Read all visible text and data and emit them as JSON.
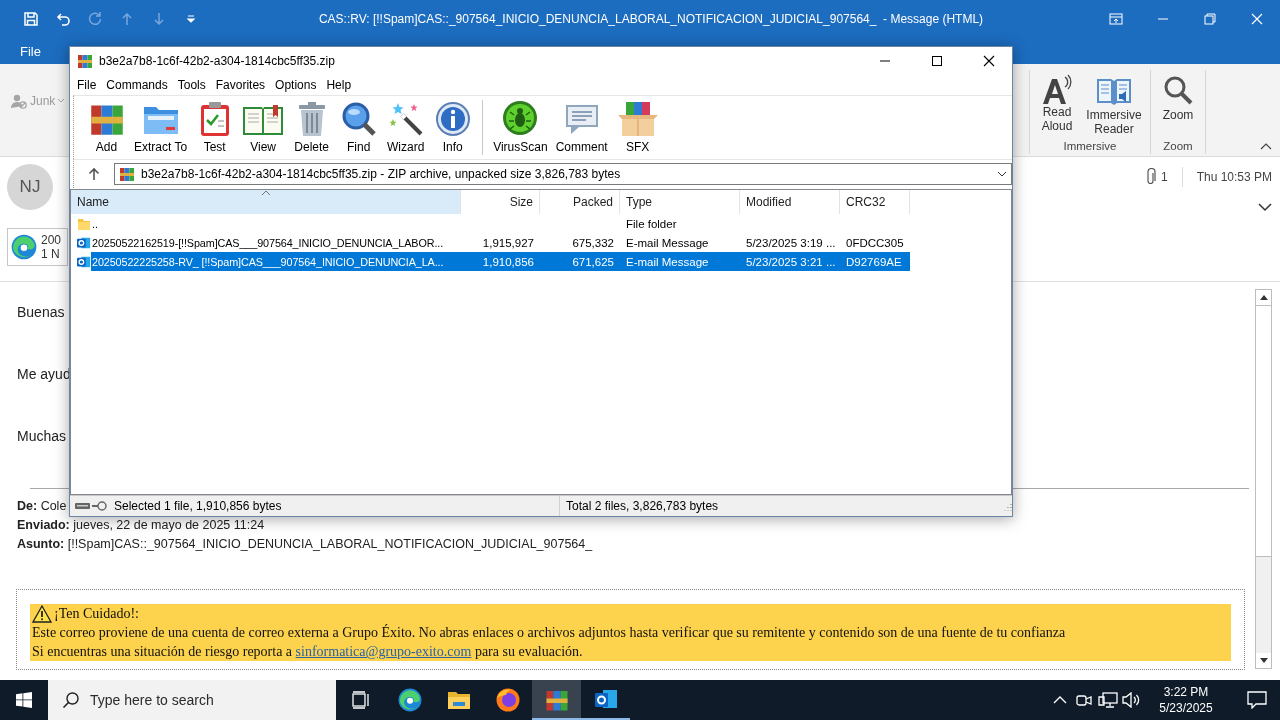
{
  "outlook": {
    "title": "CAS::RV: [!!Spam]CAS::_907564_INICIO_DENUNCIA_LABORAL_NOTIFICACION_JUDICIAL_907564_  - Message (HTML)",
    "tabs": [
      {
        "label": "File",
        "selected": false
      }
    ],
    "ribbon": {
      "junk": {
        "label": "Junk",
        "disabled": true
      },
      "groups": [
        {
          "label": "Immersive",
          "buttons": [
            "Read Aloud",
            "Immersive Reader"
          ]
        },
        {
          "label": "Zoom",
          "buttons": [
            "Zoom"
          ]
        }
      ]
    },
    "header": {
      "avatar": "NJ",
      "attachment_count": "1",
      "received": "Thu 10:53 PM",
      "attachment": {
        "name": "200",
        "size": "1 N"
      }
    },
    "body": {
      "lines": [
        "Buenas",
        "Me ayud",
        "Muchas"
      ],
      "fields": [
        {
          "label": "De:",
          "value": "Cole"
        },
        {
          "label": "Enviado:",
          "value": "jueves, 22 de mayo de 2025 11:24"
        },
        {
          "label": "Asunto:",
          "value": "[!!Spam]CAS::_907564_INICIO_DENUNCIA_LABORAL_NOTIFICACION_JUDICIAL_907564_"
        }
      ],
      "warning": {
        "title": "¡Ten Cuidado!:",
        "text": "Este correo proviene de una cuenta de correo externa a Grupo Éxito. No abras enlaces o archivos adjuntos hasta verificar que su remitente y contenido son de una fuente de tu confianza",
        "report": "Si encuentras una situación de riesgo reporta a",
        "link": "sinformatica@grupo-exito.com",
        "after_link": "para su evaluación."
      }
    }
  },
  "archive": {
    "title": "b3e2a7b8-1c6f-42b2-a304-1814cbc5ff35.zip",
    "menu": [
      "File",
      "Commands",
      "Tools",
      "Favorites",
      "Options",
      "Help"
    ],
    "toolbar_groups": [
      {
        "buttons": [
          "Add",
          "Extract To",
          "Test",
          "View",
          "Delete",
          "Find",
          "Wizard",
          "Info"
        ]
      },
      {
        "buttons": [
          "VirusScan",
          "Comment",
          "SFX"
        ]
      }
    ],
    "path": "b3e2a7b8-1c6f-42b2-a304-1814cbc5ff35.zip - ZIP archive, unpacked size 3,826,783 bytes",
    "columns": [
      {
        "label": "Name",
        "sorted": true
      },
      {
        "label": "Size",
        "sorted": false
      },
      {
        "label": "Packed",
        "sorted": false
      },
      {
        "label": "Type",
        "sorted": false
      },
      {
        "label": "Modified",
        "sorted": false
      },
      {
        "label": "CRC32",
        "sorted": false
      }
    ],
    "rows": [
      {
        "kind": "folder",
        "name": "..",
        "type": "File folder",
        "selected": false
      },
      {
        "kind": "email",
        "name": "20250522162519-[!!Spam]CAS___907564_INICIO_DENUNCIA_LABOR...",
        "size": "1,915,927",
        "packed": "675,332",
        "type": "E-mail Message",
        "modified": "5/23/2025 3:19 ...",
        "crc32": "0FDCC305",
        "selected": false
      },
      {
        "kind": "email",
        "name": "20250522225258-RV_ [!!Spam]CAS___907564_INICIO_DENUNCIA_LA...",
        "size": "1,910,856",
        "packed": "671,625",
        "type": "E-mail Message",
        "modified": "5/23/2025 3:21 ...",
        "crc32": "D92769AE",
        "selected": true
      }
    ],
    "status": {
      "selection": "Selected 1 file, 1,910,856 bytes",
      "total": "Total 2 files, 3,826,783 bytes"
    }
  },
  "taskbar": {
    "search_placeholder": "Type here to search",
    "apps": [
      {
        "kind": "task-view",
        "selected": false,
        "running": false
      },
      {
        "kind": "edge",
        "selected": false,
        "running": false
      },
      {
        "kind": "explorer",
        "selected": false,
        "running": false
      },
      {
        "kind": "firefox",
        "selected": false,
        "running": false
      },
      {
        "kind": "winrar",
        "selected": true,
        "running": true
      },
      {
        "kind": "outlook",
        "selected": false,
        "running": true
      }
    ],
    "time": "3:22 PM",
    "date": "5/23/2025"
  }
}
